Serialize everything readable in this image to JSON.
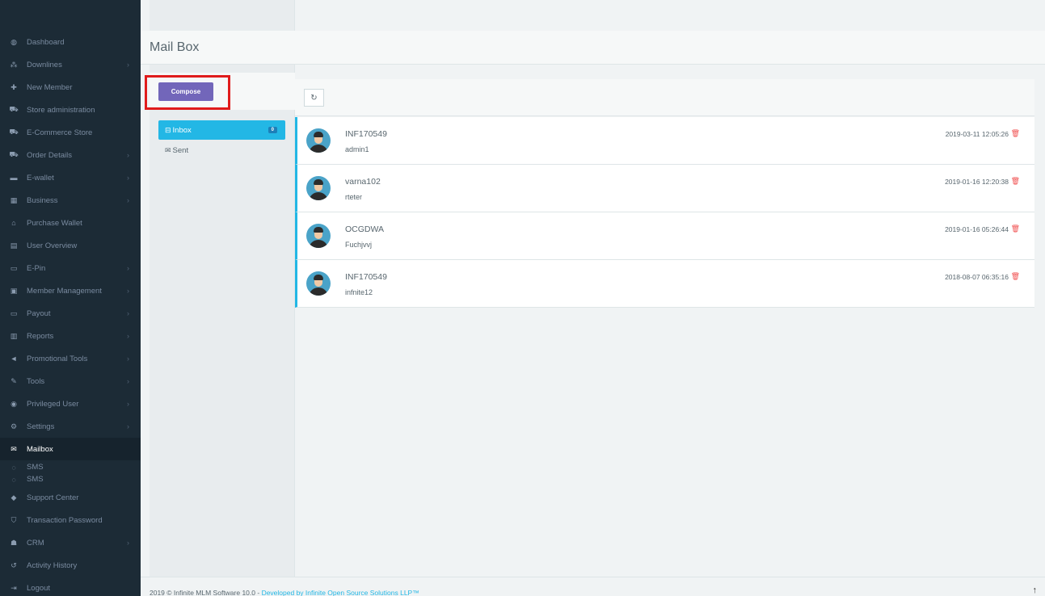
{
  "sidebar": {
    "items": [
      {
        "icon": "dashboard-icon",
        "glyph": "◍",
        "label": "Dashboard",
        "chevron": false
      },
      {
        "icon": "sitemap-icon",
        "glyph": "⁂",
        "label": "Downlines",
        "chevron": true
      },
      {
        "icon": "user-plus-icon",
        "glyph": "✚",
        "label": "New Member",
        "chevron": false
      },
      {
        "icon": "cart-icon",
        "glyph": "⛟",
        "label": "Store administration",
        "chevron": false
      },
      {
        "icon": "cart-icon",
        "glyph": "⛟",
        "label": "E-Commerce Store",
        "chevron": false
      },
      {
        "icon": "cart-icon",
        "glyph": "⛟",
        "label": "Order Details",
        "chevron": true
      },
      {
        "icon": "briefcase-icon",
        "glyph": "▬",
        "label": "E-wallet",
        "chevron": true
      },
      {
        "icon": "building-icon",
        "glyph": "▦",
        "label": "Business",
        "chevron": true
      },
      {
        "icon": "bank-icon",
        "glyph": "⌂",
        "label": "Purchase Wallet",
        "chevron": false
      },
      {
        "icon": "id-card-icon",
        "glyph": "▤",
        "label": "User Overview",
        "chevron": false
      },
      {
        "icon": "bookmark-icon",
        "glyph": "▭",
        "label": "E-Pin",
        "chevron": true
      },
      {
        "icon": "user-box-icon",
        "glyph": "▣",
        "label": "Member Management",
        "chevron": true
      },
      {
        "icon": "money-icon",
        "glyph": "▭",
        "label": "Payout",
        "chevron": true
      },
      {
        "icon": "bar-chart-icon",
        "glyph": "▥",
        "label": "Reports",
        "chevron": true
      },
      {
        "icon": "bullhorn-icon",
        "glyph": "◄",
        "label": "Promotional Tools",
        "chevron": true
      },
      {
        "icon": "wrench-icon",
        "glyph": "✎",
        "label": "Tools",
        "chevron": true
      },
      {
        "icon": "user-circle-icon",
        "glyph": "◉",
        "label": "Privileged User",
        "chevron": true
      },
      {
        "icon": "cogs-icon",
        "glyph": "⚙",
        "label": "Settings",
        "chevron": true
      },
      {
        "icon": "envelope-icon",
        "glyph": "✉",
        "label": "Mailbox",
        "chevron": false,
        "active": true
      }
    ],
    "sms_label_1": "SMS",
    "sms_label_2": "SMS",
    "items_after": [
      {
        "icon": "ticket-icon",
        "glyph": "◆",
        "label": "Support Center",
        "chevron": false
      },
      {
        "icon": "shield-icon",
        "glyph": "⛉",
        "label": "Transaction Password",
        "chevron": false
      },
      {
        "icon": "users-icon",
        "glyph": "☗",
        "label": "CRM",
        "chevron": true
      },
      {
        "icon": "history-icon",
        "glyph": "↺",
        "label": "Activity History",
        "chevron": false
      },
      {
        "icon": "logout-icon",
        "glyph": "⇥",
        "label": "Logout",
        "chevron": false
      }
    ]
  },
  "header": {
    "title": "Mail Box"
  },
  "mail_nav": {
    "compose_label": "Compose",
    "inbox_label": "Inbox",
    "inbox_count": "0",
    "sent_label": "Sent"
  },
  "toolbar": {
    "refresh_icon": "refresh-icon"
  },
  "messages": [
    {
      "sender": "INF170549",
      "subject": "admin1",
      "date": "2019-03-11 12:05:26"
    },
    {
      "sender": "varna102",
      "subject": "rteter",
      "date": "2019-01-16 12:20:38"
    },
    {
      "sender": "OCGDWA",
      "subject": "Fuchjvvj",
      "date": "2019-01-16 05:26:44"
    },
    {
      "sender": "INF170549",
      "subject": "infnite12",
      "date": "2018-08-07 06:35:16"
    }
  ],
  "footer": {
    "text": "2019 © Infinite MLM Software 10.0 - ",
    "link": "Developed by Infinite Open Source Solutions LLP™"
  }
}
